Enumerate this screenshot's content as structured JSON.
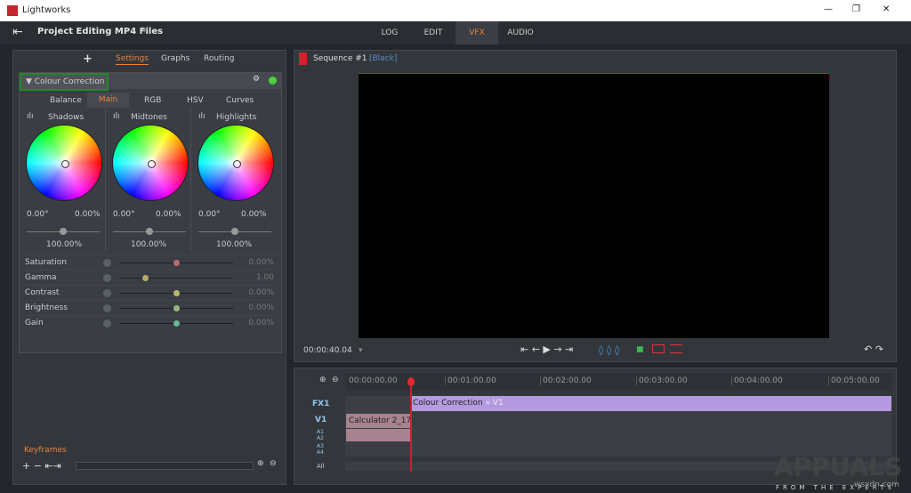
{
  "window": {
    "title": "Lightworks",
    "min": "—",
    "max": "❐",
    "close": "✕"
  },
  "project": {
    "title": "Project Editing MP4 Files",
    "caret": "▾",
    "exit_icon": "⇤"
  },
  "tabs": [
    {
      "label": "LOG"
    },
    {
      "label": "EDIT"
    },
    {
      "label": "VFX"
    },
    {
      "label": "AUDIO"
    }
  ],
  "left": {
    "add": "+",
    "tabs": [
      {
        "label": "Settings"
      },
      {
        "label": "Graphs"
      },
      {
        "label": "Routing"
      }
    ],
    "effect": {
      "name": "▼ Colour Correction"
    },
    "subtabs": [
      {
        "label": "Balance"
      },
      {
        "label": "Main"
      },
      {
        "label": "RGB"
      },
      {
        "label": "HSV"
      },
      {
        "label": "Curves"
      }
    ],
    "wheels": [
      {
        "name": "Shadows",
        "angle": "0.00°",
        "amount": "0.00%",
        "level": "100.00%"
      },
      {
        "name": "Midtones",
        "angle": "0.00°",
        "amount": "0.00%",
        "level": "100.00%"
      },
      {
        "name": "Highlights",
        "angle": "0.00°",
        "amount": "0.00%",
        "level": "100.00%"
      }
    ],
    "sliders": [
      {
        "label": "Saturation",
        "value": "0.00%",
        "pos": 0.5,
        "color": "#b86a72"
      },
      {
        "label": "Gamma",
        "value": "1.00",
        "pos": 0.23,
        "color": "#b8a86a"
      },
      {
        "label": "Contrast",
        "value": "0.00%",
        "pos": 0.5,
        "color": "#b8b86a"
      },
      {
        "label": "Brightness",
        "value": "0.00%",
        "pos": 0.5,
        "color": "#9ab87a"
      },
      {
        "label": "Gain",
        "value": "0.00%",
        "pos": 0.5,
        "color": "#6ab89a"
      }
    ],
    "keyframes": {
      "label": "Keyframes",
      "controls": "+ − ⇤⇥"
    }
  },
  "viewer": {
    "title": "Sequence #1",
    "tag": "[Black]",
    "timecode": "00:00:40.04",
    "transport": "⇤ ← ▶ → ⇥",
    "undo": "↶ ↷"
  },
  "timeline": {
    "ruler": [
      "00:00:00.00",
      "00:01:00.00",
      "00:02:00.00",
      "00:03:00.00",
      "00:04:00.00",
      "00:05:00.00"
    ],
    "tracks": {
      "fx1": "FX1",
      "v1": "V1",
      "a1": "A1",
      "a2": "A2",
      "a3": "A3",
      "a4": "A4",
      "all": "All"
    },
    "clips": {
      "fx": "Colour Correction",
      "fx_src": "« V1",
      "video": "Calculator 2_17"
    }
  },
  "watermark": {
    "text": "APPUALS",
    "sub": "FROM THE EXPERTS",
    "site": "wsxdn.com"
  }
}
